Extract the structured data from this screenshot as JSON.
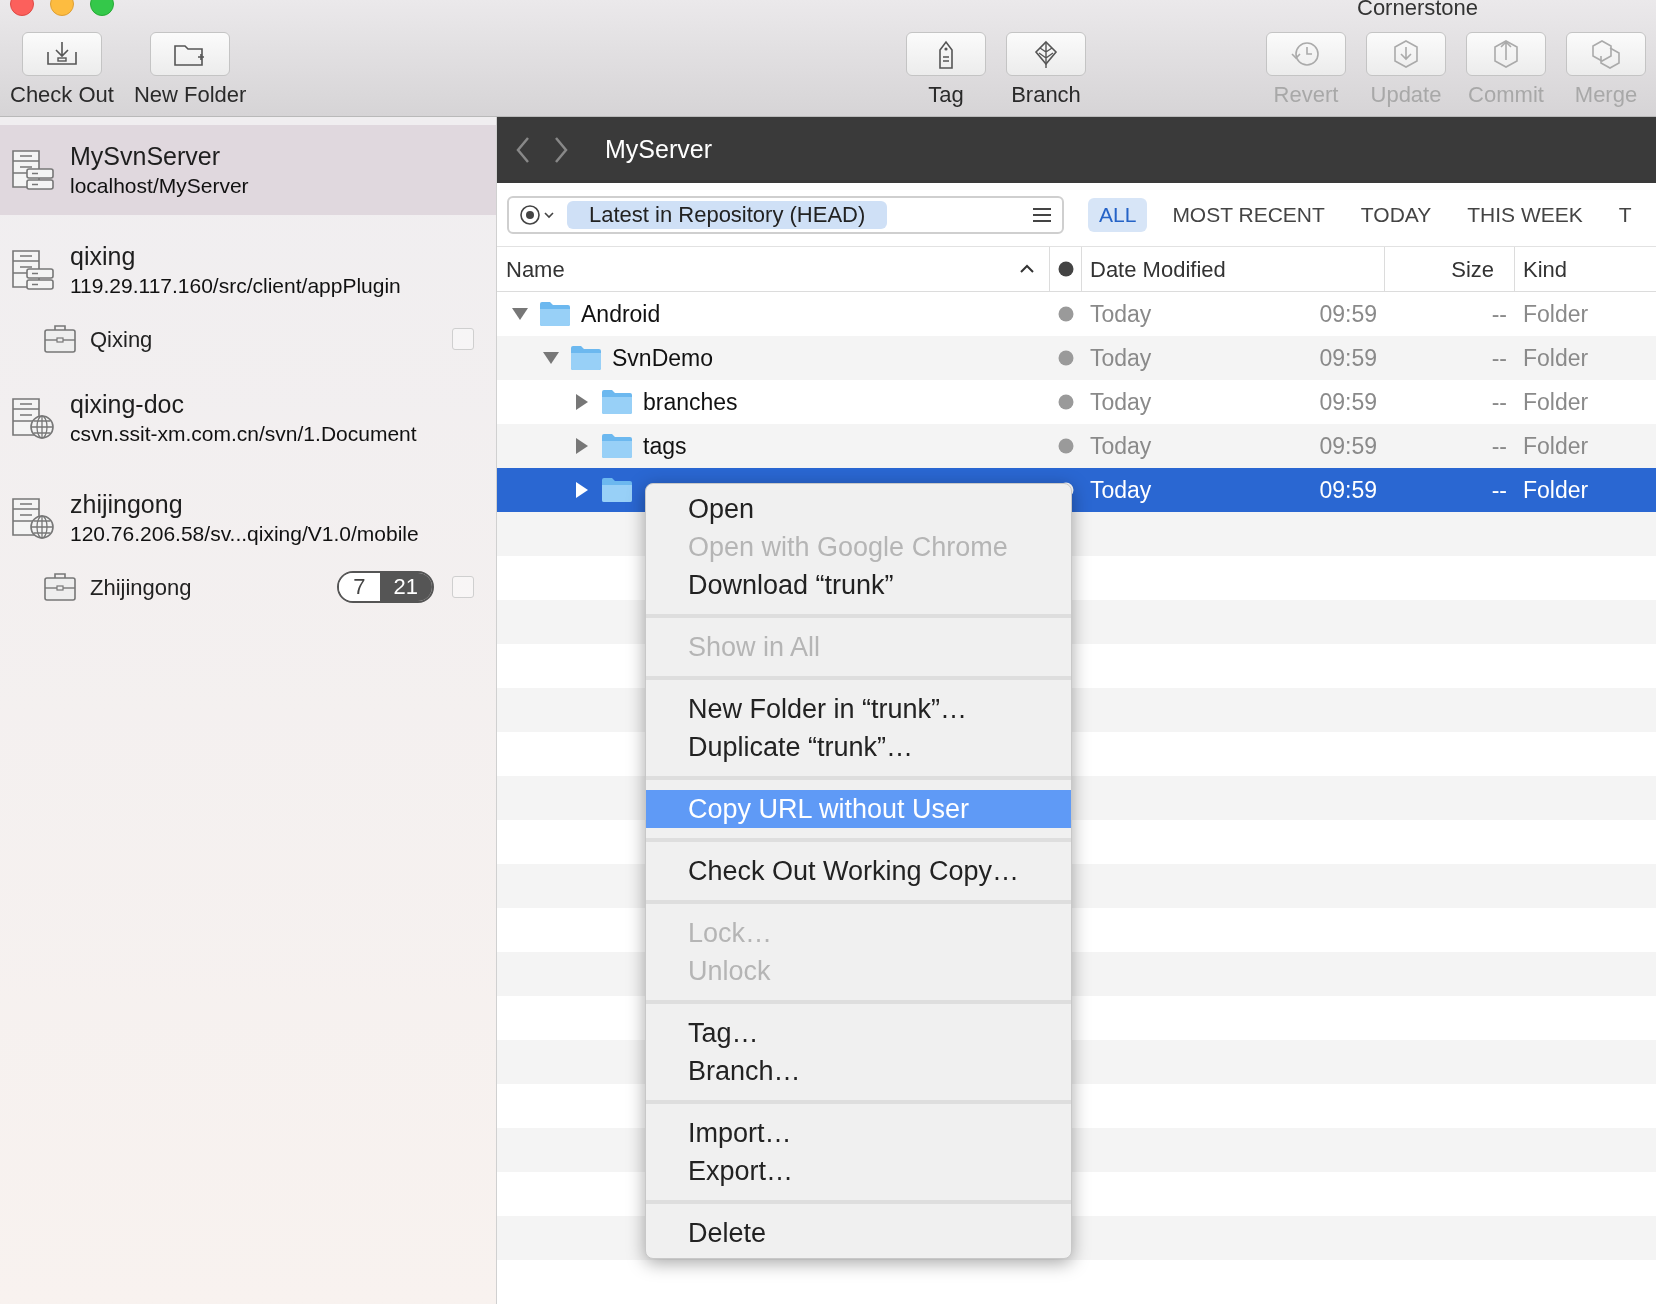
{
  "window": {
    "title": "Cornerstone"
  },
  "toolbar": {
    "left": [
      {
        "label": "Check Out",
        "kind": "checkout",
        "disabled": false
      },
      {
        "label": "New Folder",
        "kind": "new-folder",
        "disabled": false
      }
    ],
    "center": [
      {
        "label": "Tag",
        "kind": "tag",
        "disabled": false
      },
      {
        "label": "Branch",
        "kind": "branch",
        "disabled": false
      }
    ],
    "right": [
      {
        "label": "Revert",
        "kind": "revert",
        "disabled": true
      },
      {
        "label": "Update",
        "kind": "update",
        "disabled": true
      },
      {
        "label": "Commit",
        "kind": "commit",
        "disabled": true
      },
      {
        "label": "Merge",
        "kind": "merge",
        "disabled": true
      }
    ]
  },
  "sidebar": {
    "repositories": [
      {
        "name": "MySvnServer",
        "address": "localhost/MyServer",
        "kind": "local",
        "selected": true
      },
      {
        "name": "qixing",
        "address": "119.29.117.160/src/client/appPlugin",
        "kind": "local",
        "selected": false,
        "working_copies": [
          {
            "name": "Qixing",
            "checked": false
          }
        ]
      },
      {
        "name": "qixing-doc",
        "address": "csvn.ssit-xm.com.cn/svn/1.Document",
        "kind": "remote",
        "selected": false
      },
      {
        "name": "zhijingong",
        "address": "120.76.206.58/sv...qixing/V1.0/mobile",
        "kind": "remote",
        "selected": false,
        "working_copies": [
          {
            "name": "Zhijingong",
            "checked": false,
            "counts": [
              "7",
              "21"
            ]
          }
        ]
      }
    ]
  },
  "browser": {
    "title": "MyServer",
    "revision": "Latest in Repository (HEAD)",
    "filters": [
      {
        "label": "ALL",
        "selected": true
      },
      {
        "label": "MOST RECENT",
        "selected": false
      },
      {
        "label": "TODAY",
        "selected": false
      },
      {
        "label": "THIS WEEK",
        "selected": false
      },
      {
        "label": "T",
        "selected": false
      }
    ],
    "columns": [
      "Name",
      "Date Modified",
      "Size",
      "Kind"
    ],
    "rows": [
      {
        "name": "Android",
        "date": "Today",
        "time": "09:59",
        "size": "--",
        "kind": "Folder",
        "expanded": true,
        "selected": false,
        "children": [
          {
            "name": "SvnDemo",
            "date": "Today",
            "time": "09:59",
            "size": "--",
            "kind": "Folder",
            "expanded": true,
            "selected": false,
            "children": [
              {
                "name": "branches",
                "date": "Today",
                "time": "09:59",
                "size": "--",
                "kind": "Folder",
                "expanded": false,
                "selected": false
              },
              {
                "name": "tags",
                "date": "Today",
                "time": "09:59",
                "size": "--",
                "kind": "Folder",
                "expanded": false,
                "selected": false
              },
              {
                "date": "Today",
                "time": "09:59",
                "size": "--",
                "kind": "Folder",
                "expanded": false,
                "selected": true
              }
            ]
          }
        ]
      }
    ]
  },
  "context_menu": {
    "sections": [
      [
        {
          "label": "Open",
          "disabled": false,
          "selected": false
        },
        {
          "label": "Open with Google Chrome",
          "disabled": true,
          "selected": false
        },
        {
          "label": "Download “trunk”",
          "disabled": false,
          "selected": false
        }
      ],
      [
        {
          "label": "Show in All",
          "disabled": true,
          "selected": false
        }
      ],
      [
        {
          "label": "New Folder in “trunk”…",
          "disabled": false,
          "selected": false
        },
        {
          "label": "Duplicate “trunk”…",
          "disabled": false,
          "selected": false
        }
      ],
      [
        {
          "label": "Copy URL without User",
          "disabled": false,
          "selected": true
        }
      ],
      [
        {
          "label": "Check Out Working Copy…",
          "disabled": false,
          "selected": false
        }
      ],
      [
        {
          "label": "Lock…",
          "disabled": true,
          "selected": false
        },
        {
          "label": "Unlock",
          "disabled": true,
          "selected": false
        }
      ],
      [
        {
          "label": "Tag…",
          "disabled": false,
          "selected": false
        },
        {
          "label": "Branch…",
          "disabled": false,
          "selected": false
        }
      ],
      [
        {
          "label": "Import…",
          "disabled": false,
          "selected": false
        },
        {
          "label": "Export…",
          "disabled": false,
          "selected": false
        }
      ],
      [
        {
          "label": "Delete",
          "disabled": false,
          "selected": false
        }
      ]
    ]
  }
}
